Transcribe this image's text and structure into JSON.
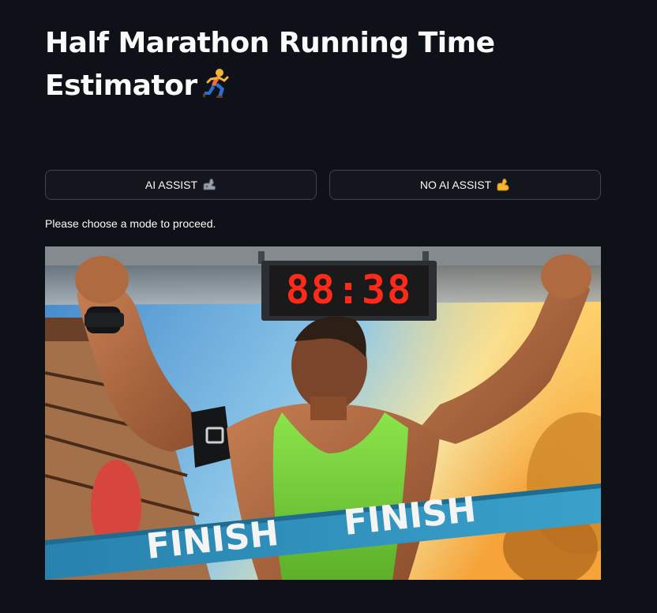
{
  "page": {
    "title": "Half Marathon Running Time Estimator",
    "title_icon": "person-running-icon"
  },
  "modes": {
    "ai_assist_label": "AI ASSIST",
    "ai_assist_icon": "mechanical-arm-icon",
    "no_ai_assist_label": "NO AI ASSIST",
    "no_ai_assist_icon": "flexed-biceps-icon"
  },
  "hint": "Please choose a mode to proceed.",
  "hero_image": {
    "clock_text": "88:38",
    "ribbon_text_left": "FINISH",
    "ribbon_text_right": "FINISH"
  },
  "colors": {
    "background": "#0e1117",
    "text": "#fafafa",
    "button_border": "rgba(250,250,250,0.2)",
    "clock_digits": "#ff2a1a",
    "ribbon": "#2a8fb8",
    "vest": "#7ddc3a"
  }
}
